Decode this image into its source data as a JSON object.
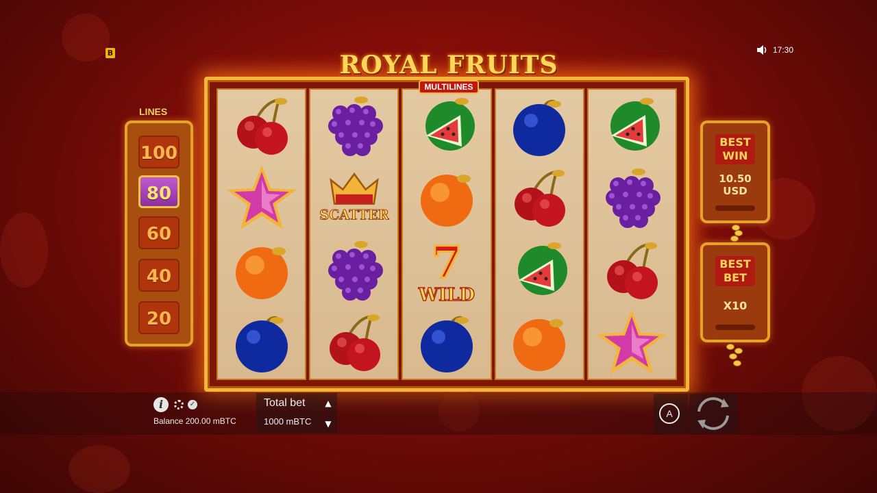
{
  "game": {
    "title": "ROYAL FRUITS",
    "subtitle": "MULTILINES"
  },
  "header": {
    "brand_badge": "B",
    "time": "17:30",
    "sound_icon": "speaker-icon"
  },
  "lines_panel": {
    "title": "LINES",
    "options": [
      "100",
      "80",
      "60",
      "40",
      "20"
    ],
    "selected": "80"
  },
  "reels": [
    [
      "cherry",
      "star",
      "orange",
      "plum"
    ],
    [
      "grapes",
      "scatter",
      "grapes",
      "cherry"
    ],
    [
      "watermelon",
      "orange",
      "wild",
      "plum"
    ],
    [
      "plum",
      "cherry",
      "watermelon",
      "orange"
    ],
    [
      "watermelon",
      "grapes",
      "cherry",
      "star"
    ]
  ],
  "symbol_text": {
    "scatter": "SCATTER",
    "wild_number": "7",
    "wild": "WILD"
  },
  "best_win": {
    "label_line1": "BEST",
    "label_line2": "WIN",
    "value_line1": "10.50",
    "value_line2": "USD"
  },
  "best_bet": {
    "label_line1": "BEST",
    "label_line2": "BET",
    "value": "X10"
  },
  "bottom_bar": {
    "info_icon": "i",
    "balance": "Balance 200.00 mBTC",
    "total_bet_label": "Total bet",
    "total_bet_value": "1000 mBTC",
    "autoplay_label": "A"
  },
  "colors": {
    "gold": "#f3b53a",
    "reel_bg": "#e3c9a2",
    "selected_line": "#8c2fa1"
  }
}
